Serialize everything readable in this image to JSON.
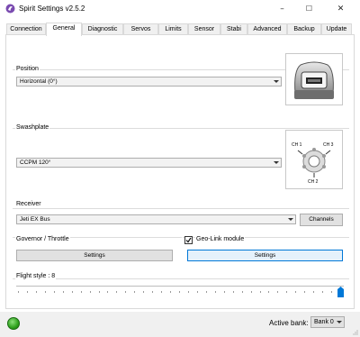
{
  "window": {
    "title": "Spirit Settings v2.5.2",
    "minimize": "–",
    "maximize": "☐",
    "close": "✕"
  },
  "tabs": [
    {
      "label": "Connection"
    },
    {
      "label": "General",
      "active": true
    },
    {
      "label": "Diagnostic"
    },
    {
      "label": "Servos"
    },
    {
      "label": "Limits"
    },
    {
      "label": "Sensor"
    },
    {
      "label": "Stabi"
    },
    {
      "label": "Advanced"
    },
    {
      "label": "Backup"
    },
    {
      "label": "Update"
    }
  ],
  "position": {
    "label": "Position",
    "value": "Horizontal (0°)"
  },
  "swashplate": {
    "label": "Swashplate",
    "value": "CCPM 120°",
    "ch1": "CH 1",
    "ch2": "CH 2",
    "ch3": "CH 3"
  },
  "receiver": {
    "label": "Receiver",
    "value": "Jeti EX Bus",
    "channels_button": "Channels"
  },
  "governor": {
    "label": "Governor / Throttle",
    "settings_button": "Settings"
  },
  "geolink": {
    "label": "Geo-Link module",
    "checked": true,
    "settings_button": "Settings"
  },
  "flight_style": {
    "label": "Flight style : 8",
    "value": 8,
    "min": 1,
    "max": 8
  },
  "statusbar": {
    "active_bank_label": "Active bank:",
    "active_bank_value": "Bank 0"
  },
  "colors": {
    "accent": "#0078d7",
    "status_ok": "#2ea11c"
  }
}
